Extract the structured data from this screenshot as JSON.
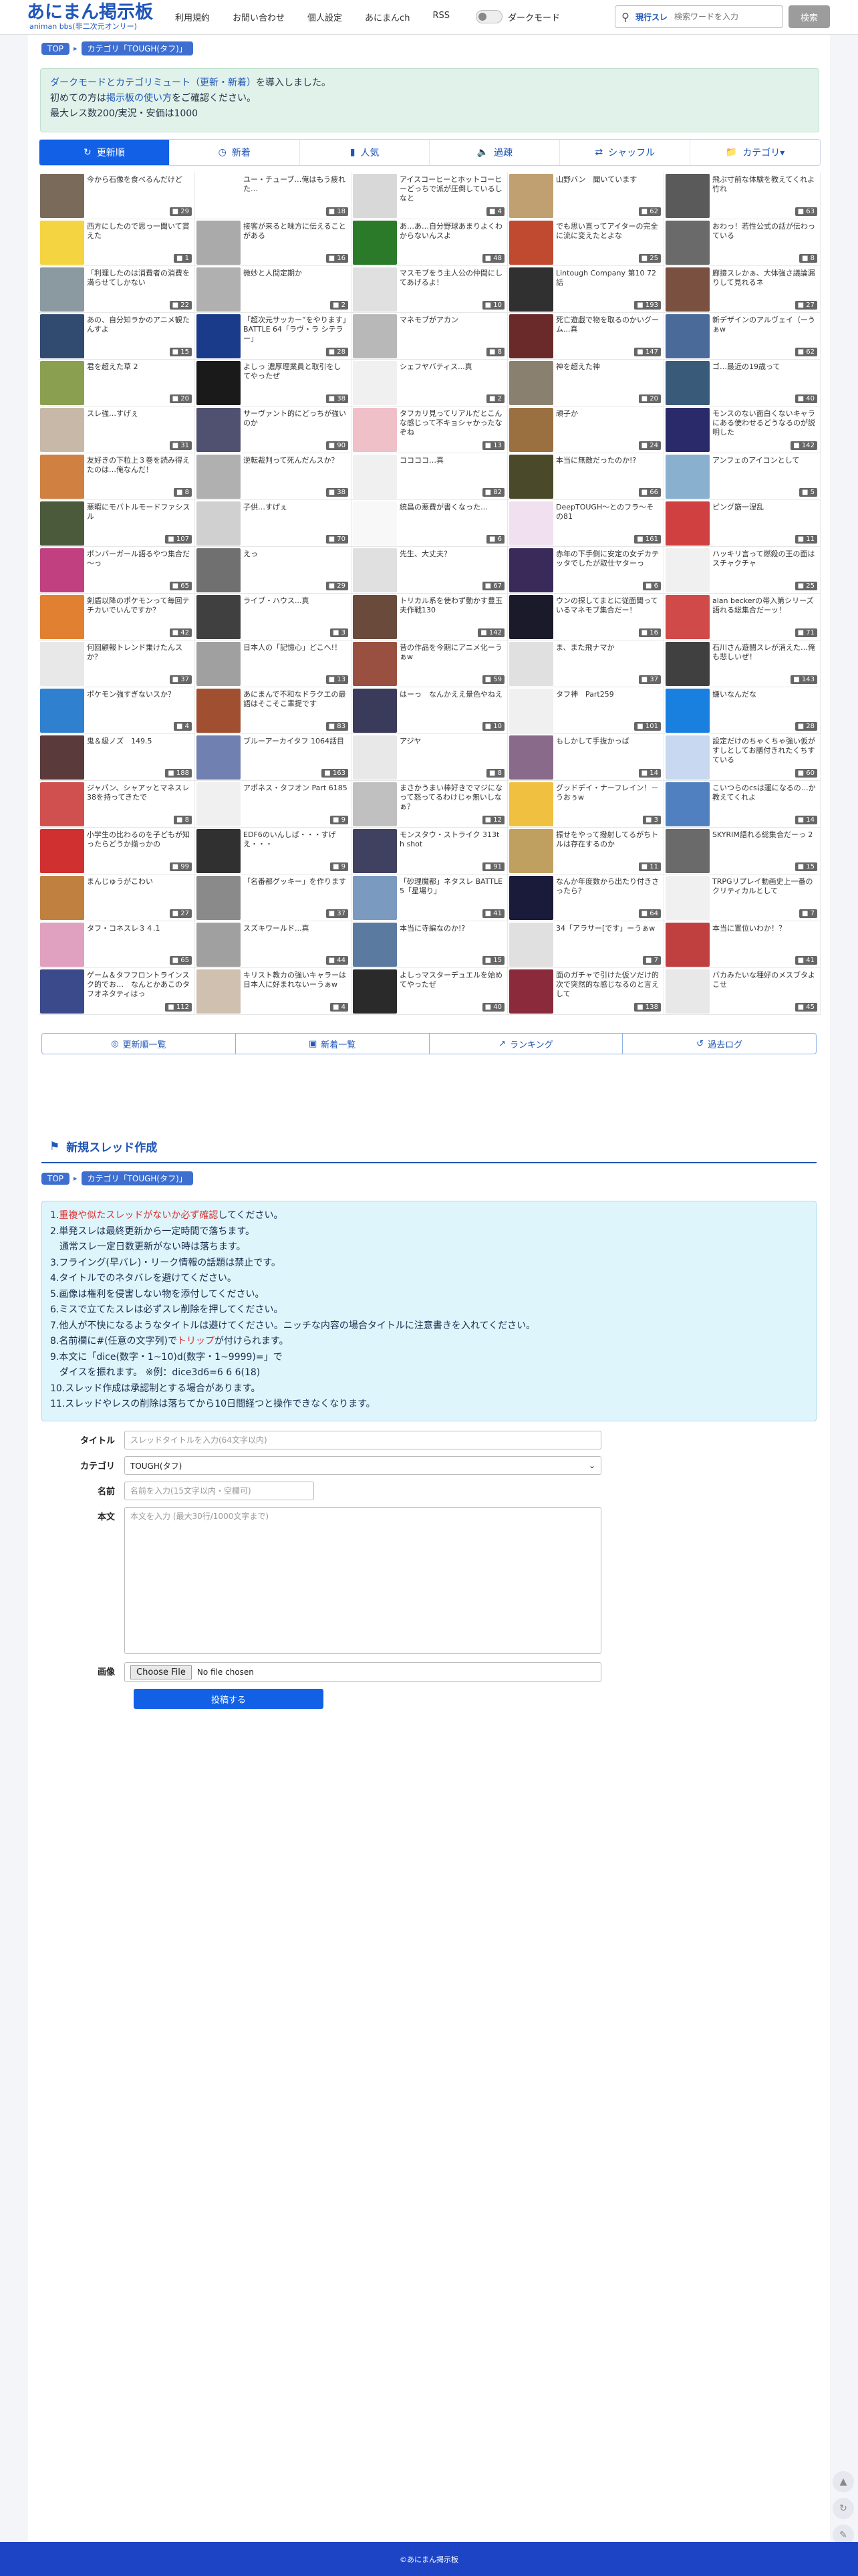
{
  "site": {
    "logo": "あにまん掲示板",
    "logo_sub": "animan bbs(非二次元オンリー)"
  },
  "nav": [
    "利用規約",
    "お問い合わせ",
    "個人設定",
    "あにまんch",
    "RSS"
  ],
  "dark_mode_label": "ダークモード",
  "search": {
    "scope": "現行スレ",
    "placeholder": "検索ワードを入力",
    "button": "検索"
  },
  "breadcrumb": [
    "TOP",
    "カテゴリ「TOUGH(タフ)」"
  ],
  "notice": {
    "line1_link": "ダークモードとカテゴリミュート（更新・新着）",
    "line1_rest": "を導入しました。",
    "line2_pre": "初めての方は",
    "line2_link": "掲示板の使い方",
    "line2_post": "をご確認ください。",
    "line3": "最大レス数200/実況・安価は1000"
  },
  "tabs": [
    "更新順",
    "新着",
    "人気",
    "過疎",
    "シャッフル",
    "カテゴリ▾"
  ],
  "threads": [
    {
      "title": "今から石像を食べるんだけど",
      "count": "29",
      "color": "#7a6a5a"
    },
    {
      "title": "ユー・チューブ…俺はもう疲れた…",
      "count": "18",
      "color": "#ffffff"
    },
    {
      "title": "アイスコーヒーとホットコーヒーどっちで派が圧倒しているしなと",
      "count": "4",
      "color": "#d8d8d8"
    },
    {
      "title": "山野バン　聞いています",
      "count": "62",
      "color": "#c0a070"
    },
    {
      "title": "飛ぶ寸前な体験を教えてくれよ竹れ",
      "count": "63",
      "color": "#5a5a5a"
    },
    {
      "title": "西方にしたので思っ一聞いて賞えた",
      "count": "1",
      "color": "#f5d442"
    },
    {
      "title": "接客が来ると味方に伝えることがある",
      "count": "16",
      "color": "#aaaaaa"
    },
    {
      "title": "あ…あ…自分野球あまりよくわからないんスよ",
      "count": "48",
      "color": "#2a7a2a"
    },
    {
      "title": "でも思い直ってアイターの完全に流に変えたとよな",
      "count": "25",
      "color": "#c04a30"
    },
    {
      "title": "おわっ！若性公式の話が伝わっている",
      "count": "8",
      "color": "#6a6a6a"
    },
    {
      "title": "「利理したのは消費者の消費を満らせてしかない",
      "count": "22",
      "color": "#8a9aa0"
    },
    {
      "title": "微妙と人間定期か",
      "count": "2",
      "color": "#b0b0b0"
    },
    {
      "title": "マスモブをう主人公の仲間にしてあげるよ！",
      "count": "10",
      "color": "#e0e0e0"
    },
    {
      "title": "Lintough Company 第10 72話",
      "count": "193",
      "color": "#303030"
    },
    {
      "title": "廊接スレかぁ、大体強さ議論漏りして見れるネ",
      "count": "27",
      "color": "#7a5040"
    },
    {
      "title": "あの、自分知ラかのアニメ観たんすよ",
      "count": "15",
      "color": "#304a70"
    },
    {
      "title": "「超次元サッカー”をやります」BATTLE 64「ラヴ・ラ シテラー」",
      "count": "28",
      "color": "#1a3a8a"
    },
    {
      "title": "マネモブがアカン",
      "count": "8",
      "color": "#b8b8b8"
    },
    {
      "title": "死亡遊戯で物を取るのかいグーム...真",
      "count": "147",
      "color": "#6a2a2a"
    },
    {
      "title": "新デザインのアルヴェイ（ーうぁw",
      "count": "62",
      "color": "#4a6a9a"
    },
    {
      "title": "君を超えた草 2",
      "count": "20",
      "color": "#8aa050"
    },
    {
      "title": "よしっ 濃厚理業員と取引をしてやったぜ",
      "count": "38",
      "color": "#1a1a1a"
    },
    {
      "title": "シェフヤバティス...真",
      "count": "2",
      "color": "#f0f0f0"
    },
    {
      "title": "神を超えた神",
      "count": "20",
      "color": "#8a8070"
    },
    {
      "title": "ゴ…最近の19歳って",
      "count": "40",
      "color": "#3a5a7a"
    },
    {
      "title": "スレ強…すげぇ",
      "count": "31",
      "color": "#c8b8a8"
    },
    {
      "title": "サーヴァント的にどっちが強いのか",
      "count": "90",
      "color": "#505070"
    },
    {
      "title": "タフカリ見ってリアルだとこんな感じって不キョシャかったなぞね",
      "count": "13",
      "color": "#f0c0c8"
    },
    {
      "title": "頑子か",
      "count": "24",
      "color": "#9a7040"
    },
    {
      "title": "モンスのない面白くないキャラにある使わせるどうなるのが説明した",
      "count": "142",
      "color": "#2a2a6a"
    },
    {
      "title": "友好きの下粒上３巻を読み得えたのは…俺なんだ！",
      "count": "8",
      "color": "#d08040"
    },
    {
      "title": "逆転裁判って死んだんスか？",
      "count": "38",
      "color": "#b0b0b0"
    },
    {
      "title": "ココココ…真",
      "count": "82",
      "color": "#f0f0f0"
    },
    {
      "title": "本当に無敵だったのか!?",
      "count": "66",
      "color": "#4a4a2a"
    },
    {
      "title": "アンフェのアイコンとして",
      "count": "5",
      "color": "#8ab0d0"
    },
    {
      "title": "悪暇にモバトルモードファシスル",
      "count": "107",
      "color": "#4a5a3a"
    },
    {
      "title": "子供…すげぇ",
      "count": "70",
      "color": "#d0d0d0"
    },
    {
      "title": "統昌の悪費が書くなった…",
      "count": "6",
      "color": "#f8f8f8"
    },
    {
      "title": "DeepTOUGH～とのフラ～その81",
      "count": "161",
      "color": "#f0e0f0"
    },
    {
      "title": "ピング筋一涅乱",
      "count": "11",
      "color": "#d04040"
    },
    {
      "title": "ボンバーガール語るやつ集合だ～っ",
      "count": "65",
      "color": "#c04080"
    },
    {
      "title": "えっ",
      "count": "29",
      "color": "#707070"
    },
    {
      "title": "先生、大丈夫？",
      "count": "67",
      "color": "#e0e0e0"
    },
    {
      "title": "赤年の下手側に安定の女デカテッタでしたが取仕ヤターっ",
      "count": "6",
      "color": "#3a2a5a"
    },
    {
      "title": "ハッキリ言って燃殺の王の面はスチャクチャ",
      "count": "25",
      "color": "#f0f0f0"
    },
    {
      "title": "剣盾以降のポケモンって毎回テチカいでいんですか？",
      "count": "42",
      "color": "#e08030"
    },
    {
      "title": "ライブ・ハウス...真",
      "count": "3",
      "color": "#404040"
    },
    {
      "title": "トリカル系を使わず動かす豊玉夫作戦130",
      "count": "142",
      "color": "#6a4a3a"
    },
    {
      "title": "ウンの探してまとに従面聞っているマネモブ集合だー！",
      "count": "16",
      "color": "#1a1a2a"
    },
    {
      "title": "alan beckerの帯入第シリーズ語れる総集合だーッ！",
      "count": "71",
      "color": "#d04a4a"
    },
    {
      "title": "何回顧報トレンド乗けたんスか？",
      "count": "37",
      "color": "#e8e8e8"
    },
    {
      "title": "日本人の「記憶心」どこへ!！",
      "count": "13",
      "color": "#a0a0a0"
    },
    {
      "title": "昔の作品を今期にアニメ化ーうぁw",
      "count": "59",
      "color": "#9a5040"
    },
    {
      "title": "ま、また飛ナマか",
      "count": "37",
      "color": "#e0e0e0"
    },
    {
      "title": "石川さん遊闘スレが消えた…俺も悲しいぜ！",
      "count": "143",
      "color": "#404040"
    },
    {
      "title": "ポケモン強すぎないスか？",
      "count": "4",
      "color": "#3080d0"
    },
    {
      "title": "あにまんで不和なドラクエの最語はそこそこ輩提です",
      "count": "83",
      "color": "#a05030"
    },
    {
      "title": "はーっ　なんかええ景色やねえ",
      "count": "10",
      "color": "#3a3a5a"
    },
    {
      "title": "タフ神　Part259",
      "count": "101",
      "color": "#f0f0f0"
    },
    {
      "title": "嫌いなんだな",
      "count": "28",
      "color": "#1a80e0"
    },
    {
      "title": "鬼＆級ノズ　149.5",
      "count": "188",
      "color": "#5a3a3a"
    },
    {
      "title": "ブルーアーカイタフ 1064話目",
      "count": "163",
      "color": "#7080b0"
    },
    {
      "title": "アジヤ",
      "count": "8",
      "color": "#e8e8e8"
    },
    {
      "title": "もしかして手抜かっば",
      "count": "14",
      "color": "#8a6a8a"
    },
    {
      "title": "設定だけのちゃくちゃ強い仮がすしとしてお膳付きれたくちすている",
      "count": "60",
      "color": "#c8d8f0"
    },
    {
      "title": "ジャパン、シャアッとマネスレ38を持ってきたで",
      "count": "8",
      "color": "#d05050"
    },
    {
      "title": "アポネス・タフオン Part 6185",
      "count": "9",
      "color": "#f0f0f0"
    },
    {
      "title": "まさかうまい棒好きでマジになって怒ってるわけじゃ無いしなぁ？",
      "count": "12",
      "color": "#c0c0c0"
    },
    {
      "title": "グッドデイ・ナーフレイン！－うおぅw",
      "count": "3",
      "color": "#f0c040"
    },
    {
      "title": "こいつらのcsは運になるの…か教えてくれよ",
      "count": "14",
      "color": "#5080c0"
    },
    {
      "title": "小学生の比わるのを子どもが知ったらどうか揃っかの",
      "count": "99",
      "color": "#d03030"
    },
    {
      "title": "EDF6のいんしば・・・すげえ・・・",
      "count": "9",
      "color": "#303030"
    },
    {
      "title": "モンスタウ・ストライク 313th shot",
      "count": "91",
      "color": "#404060"
    },
    {
      "title": "振せをやって撥射してるがちトルは存在するのか",
      "count": "11",
      "color": "#c0a060"
    },
    {
      "title": "SKYRIM語れる総集合だーっ 2",
      "count": "15",
      "color": "#6a6a6a"
    },
    {
      "title": "まんじゅうがこわい",
      "count": "27",
      "color": "#c08040"
    },
    {
      "title": "「名番都グッキー」を作ります",
      "count": "37",
      "color": "#8a8a8a"
    },
    {
      "title": "「砂理魔都」ネタスレ BATTLE 5「星場り」",
      "count": "41",
      "color": "#7a9ac0"
    },
    {
      "title": "なんか年度数から出たり付きさったら？",
      "count": "64",
      "color": "#1a1a3a"
    },
    {
      "title": "TRPGリプレイ動画史上一番のクリティカルとして",
      "count": "7",
      "color": "#f0f0f0"
    },
    {
      "title": "タフ・コネスレ３４.1",
      "count": "65",
      "color": "#e0a0c0"
    },
    {
      "title": "スズキワールド...真",
      "count": "44",
      "color": "#a0a0a0"
    },
    {
      "title": "本当に寺編なのか!?",
      "count": "15",
      "color": "#5a7aa0"
    },
    {
      "title": "34「アラサー[です」ーうぁw",
      "count": "7",
      "color": "#e0e0e0"
    },
    {
      "title": "本当に置位いわか！？",
      "count": "41",
      "color": "#c04040"
    },
    {
      "title": "ゲーム＆タフフロントラインスク的でお…　なんとかあこのタフオネタティはっ",
      "count": "112",
      "color": "#3a4a8a"
    },
    {
      "title": "キリスト教カの強いキャラーは日本人に好まれないーうぁw",
      "count": "4",
      "color": "#d0c0b0"
    },
    {
      "title": "よしっマスターデュエルを始めてやったぜ",
      "count": "40",
      "color": "#2a2a2a"
    },
    {
      "title": "面のガチャで引けた仮ソだけ的次で突然的な感じなるのと言えして",
      "count": "138",
      "color": "#8a2a3a"
    },
    {
      "title": "バカみたいな種好のメスブタよこせ",
      "count": "45",
      "color": "#e8e8e8"
    }
  ],
  "bottom_tabs": [
    "更新順一覧",
    "新着一覧",
    "ランキング",
    "過去ログ"
  ],
  "create_section": {
    "title": "新規スレッド作成"
  },
  "rules": {
    "r1_pre": "1.",
    "r1_red": "重複や似たスレッドがないか必ず確認",
    "r1_post": "してください。",
    "r2": "2.単発スレは最終更新から一定時間で落ちます。",
    "r2b": "　通常スレ一定日数更新がない時は落ちます。",
    "r3": "3.フライング(早バレ)・リーク情報の話題は禁止です。",
    "r4": "4.タイトルでのネタバレを避けてください。",
    "r5": "5.画像は権利を侵害しない物を添付してください。",
    "r6": "6.ミスで立てたスレは必ずスレ削除を押してください。",
    "r7": "7.他人が不快になるようなタイトルは避けてください。ニッチな内容の場合タイトルに注意書きを入れてください。",
    "r8_pre": "8.名前欄に#(任意の文字列)で",
    "r8_red": "トリップ",
    "r8_post": "が付けられます。",
    "r9": "9.本文に「dice(数字・1~10)d(数字・1~9999)=」で",
    "r9b": "　ダイスを振れます。 ※例：dice3d6=6 6 6(18)",
    "r10": "10.スレッド作成は承認制とする場合があります。",
    "r11": "11.スレッドやレスの削除は落ちてから10日間経つと操作できなくなります。"
  },
  "form": {
    "title_label": "タイトル",
    "title_placeholder": "スレッドタイトルを入力(64文字以内)",
    "category_label": "カテゴリ",
    "category_value": "TOUGH(タフ)",
    "name_label": "名前",
    "name_placeholder": "名前を入力(15文字以内・空欄可)",
    "body_label": "本文",
    "body_placeholder": "本文を入力 (最大30行/1000文字まで)",
    "image_label": "画像",
    "file_button": "Choose File",
    "file_status": "No file chosen",
    "submit": "投稿する"
  },
  "footer": {
    "text": "©あにまん掲示板"
  }
}
